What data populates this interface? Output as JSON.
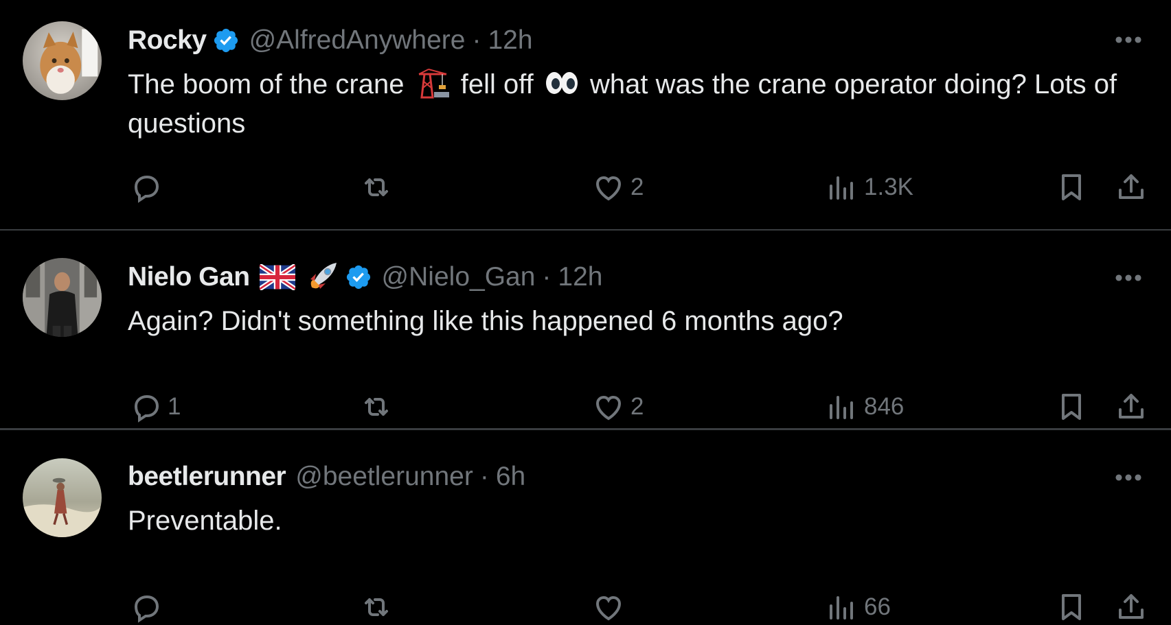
{
  "tweets": [
    {
      "display_name": "Rocky",
      "handle": "@AlfredAnywhere",
      "separator": "·",
      "time": "12h",
      "text_before": "The boom of the crane",
      "text_middle": "fell off",
      "text_after": "what was the crane operator doing? Lots of questions",
      "replies": "",
      "likes": "2",
      "views": "1.3K"
    },
    {
      "display_name": "Nielo Gan",
      "handle": "@Nielo_Gan",
      "separator": "·",
      "time": "12h",
      "text": "Again? Didn't something like this happened 6 months ago?",
      "replies": "1",
      "likes": "2",
      "views": "846"
    },
    {
      "display_name": "beetlerunner",
      "handle": "@beetlerunner",
      "separator": "·",
      "time": "6h",
      "text": "Preventable.",
      "replies": "",
      "likes": "",
      "views": "66"
    }
  ],
  "icons": [
    "verified-badge-icon",
    "more-icon",
    "reply-icon",
    "retweet-icon",
    "like-icon",
    "views-icon",
    "bookmark-icon",
    "share-icon",
    "crane-emoji-icon",
    "eyes-emoji-icon",
    "uk-flag-emoji-icon",
    "rocket-emoji-icon"
  ],
  "colors": {
    "background": "#000000",
    "text": "#e7e9ea",
    "secondary_text": "#71767b",
    "verified": "#1d9bf0",
    "divider": "#3a3d40"
  }
}
